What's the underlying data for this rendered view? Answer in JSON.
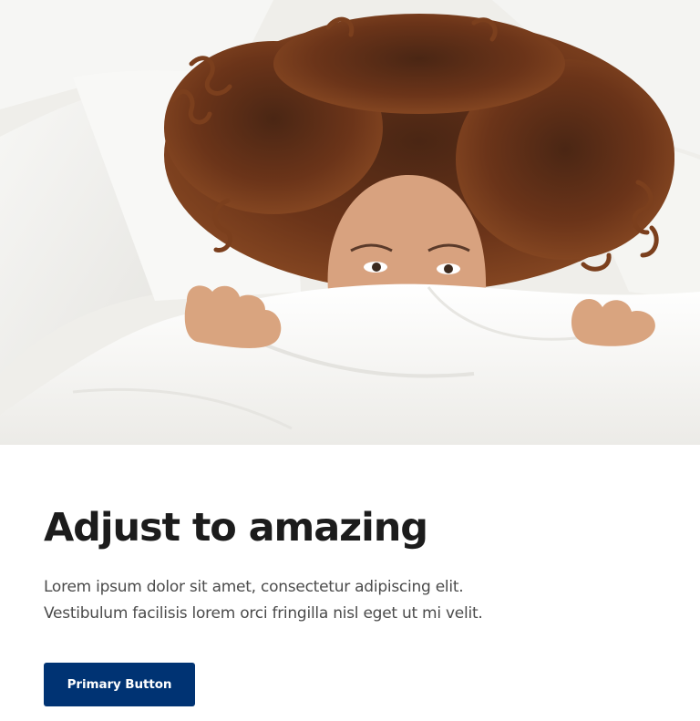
{
  "hero": {
    "image_subject": "woman-peeking-over-white-duvet",
    "colors": {
      "sheets": "#f7f6f3",
      "hair": "#6b3419",
      "skin": "#d8a27f"
    }
  },
  "headline": "Adjust to amazing",
  "body": {
    "line1": "Lorem ipsum dolor sit amet, consectetur adipiscing elit.",
    "line2": "Vestibulum facilisis lorem orci fringilla nisl eget ut mi velit."
  },
  "primary_button": {
    "label": "Primary Button",
    "color": "#003373"
  }
}
